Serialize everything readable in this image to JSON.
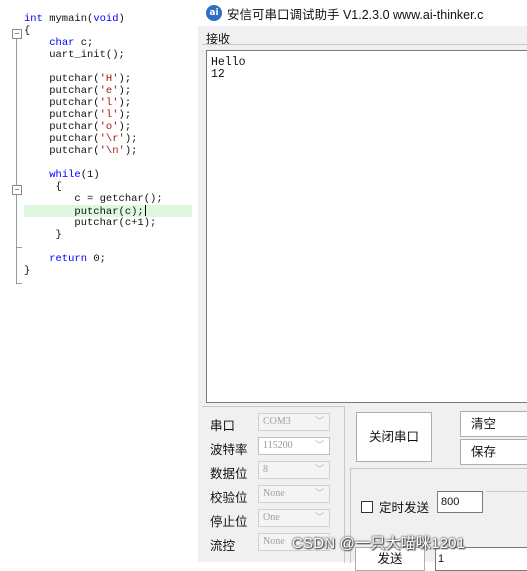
{
  "editor": {
    "lines": [
      [
        "kw:int",
        "txt: mymain(",
        "kw:void",
        "txt:)"
      ],
      [
        "txt:{"
      ],
      [
        "txt:    ",
        "kw:char",
        "txt: c;"
      ],
      [
        "txt:    uart_init();"
      ],
      [
        "txt: "
      ],
      [
        "txt:    putchar(",
        "str:'H'",
        "txt:);"
      ],
      [
        "txt:    putchar(",
        "str:'e'",
        "txt:);"
      ],
      [
        "txt:    putchar(",
        "str:'l'",
        "txt:);"
      ],
      [
        "txt:    putchar(",
        "str:'l'",
        "txt:);"
      ],
      [
        "txt:    putchar(",
        "str:'o'",
        "txt:);"
      ],
      [
        "txt:    putchar(",
        "str:'\\r'",
        "txt:);"
      ],
      [
        "txt:    putchar(",
        "str:'\\n'",
        "txt:);"
      ],
      [
        "txt: "
      ],
      [
        "txt:    ",
        "kw:while",
        "txt:(1)"
      ],
      [
        "txt:     {"
      ],
      [
        "txt:        c = getchar();"
      ],
      [
        "txt:        putchar(c);"
      ],
      [
        "txt:        putchar(c+1);"
      ],
      [
        "txt:     }"
      ],
      [
        "txt: "
      ],
      [
        "txt:    ",
        "kw:return",
        "txt: 0;"
      ],
      [
        "txt:}"
      ]
    ],
    "highlighted_line": 16,
    "caret_line": 16
  },
  "app": {
    "title": "安信可串口调试助手 V1.2.3.0    www.ai-thinker.c",
    "icon_glyph": "ai",
    "receive_label": "接收",
    "received_lines": [
      "Hello",
      "12"
    ],
    "settings": [
      {
        "label": "串口",
        "value": "COM3",
        "enabled": false
      },
      {
        "label": "波特率",
        "value": "115200",
        "enabled": true
      },
      {
        "label": "数据位",
        "value": "8",
        "enabled": false
      },
      {
        "label": "校验位",
        "value": "None",
        "enabled": false
      },
      {
        "label": "停止位",
        "value": "One",
        "enabled": false
      },
      {
        "label": "流控",
        "value": "None",
        "enabled": false
      }
    ],
    "open_button": "关闭串口",
    "clear_button": "清空",
    "save_button": "保存",
    "timed_send_label": "定时发送",
    "timed_send_checked": false,
    "interval_value": "800",
    "send_button": "发送",
    "send_input_value": "1"
  },
  "watermark": "CSDN @一只大喵咪1201"
}
